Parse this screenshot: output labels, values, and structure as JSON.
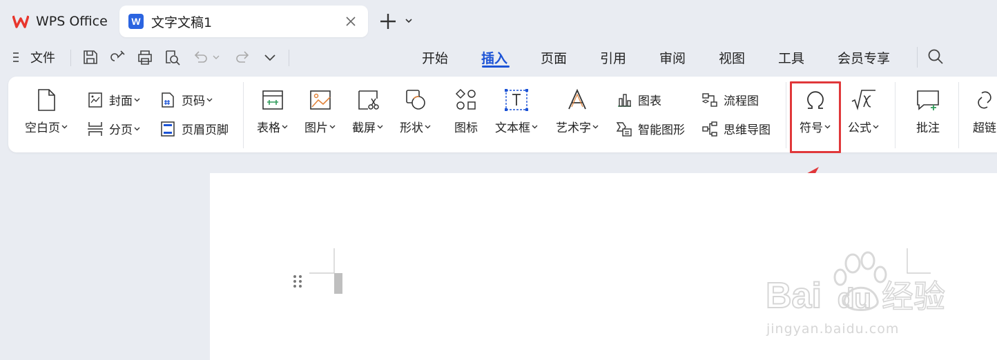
{
  "tabs": [
    {
      "label": "WPS Office",
      "icon": "wps-logo-icon"
    },
    {
      "label": "文字文稿1",
      "icon": "writer-doc-icon"
    }
  ],
  "menu": {
    "file_label": "文件",
    "tabs": [
      "开始",
      "插入",
      "页面",
      "引用",
      "审阅",
      "视图",
      "工具",
      "会员专享"
    ],
    "active_tab": "插入"
  },
  "ribbon": {
    "blank_page": "空白页",
    "cover": "封面",
    "page_break": "分页",
    "page_number": "页码",
    "header_footer": "页眉页脚",
    "table": "表格",
    "picture": "图片",
    "screenshot": "截屏",
    "shape": "形状",
    "icon": "图标",
    "textbox": "文本框",
    "wordart": "艺术字",
    "chart": "图表",
    "smartart": "智能图形",
    "flowchart": "流程图",
    "mindmap": "思维导图",
    "symbol": "符号",
    "formula": "公式",
    "comment": "批注",
    "hyperlink": "超链"
  },
  "colors": {
    "accent": "#1c53d6",
    "highlight": "#e0373a",
    "wps_red": "#e8362d",
    "writer_blue": "#2b64e0"
  },
  "watermark": {
    "text": "jingyan.baidu.com"
  }
}
